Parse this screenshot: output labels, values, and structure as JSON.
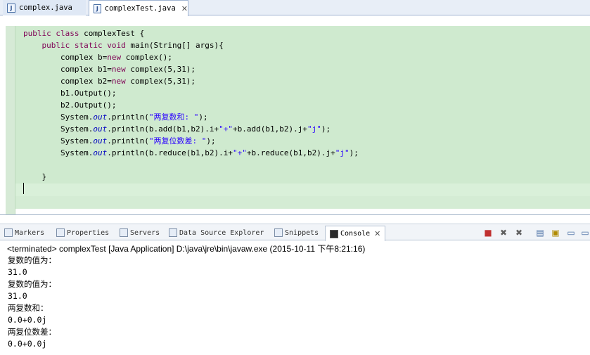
{
  "editor_tabs": [
    {
      "label": "complex.java",
      "active": false
    },
    {
      "label": "complexTest.java",
      "active": true
    }
  ],
  "code_lines": [
    [
      {
        "t": "public class",
        "c": "kw"
      },
      {
        "t": " complexTest {"
      }
    ],
    [
      {
        "t": "    "
      },
      {
        "t": "public static void",
        "c": "kw"
      },
      {
        "t": " main(String[] args){"
      }
    ],
    [
      {
        "t": "        complex b="
      },
      {
        "t": "new",
        "c": "kw"
      },
      {
        "t": " complex();"
      }
    ],
    [
      {
        "t": "        complex b1="
      },
      {
        "t": "new",
        "c": "kw"
      },
      {
        "t": " complex(5,31);"
      }
    ],
    [
      {
        "t": "        complex b2="
      },
      {
        "t": "new",
        "c": "kw"
      },
      {
        "t": " complex(5,31);"
      }
    ],
    [
      {
        "t": "        b1.Output();"
      }
    ],
    [
      {
        "t": "        b2.Output();"
      }
    ],
    [
      {
        "t": "        System."
      },
      {
        "t": "out",
        "c": "fld"
      },
      {
        "t": ".println("
      },
      {
        "t": "\"两复数和: \"",
        "c": "str"
      },
      {
        "t": ");"
      }
    ],
    [
      {
        "t": "        System."
      },
      {
        "t": "out",
        "c": "fld"
      },
      {
        "t": ".println(b.add(b1,b2).i+"
      },
      {
        "t": "\"+\"",
        "c": "str"
      },
      {
        "t": "+b.add(b1,b2).j+"
      },
      {
        "t": "\"j\"",
        "c": "str"
      },
      {
        "t": ");"
      }
    ],
    [
      {
        "t": "        System."
      },
      {
        "t": "out",
        "c": "fld"
      },
      {
        "t": ".println("
      },
      {
        "t": "\"两复位数差: \"",
        "c": "str"
      },
      {
        "t": ");"
      }
    ],
    [
      {
        "t": "        System."
      },
      {
        "t": "out",
        "c": "fld"
      },
      {
        "t": ".println(b.reduce(b1,b2).i+"
      },
      {
        "t": "\"+\"",
        "c": "str"
      },
      {
        "t": "+b.reduce(b1,b2).j+"
      },
      {
        "t": "\"j\"",
        "c": "str"
      },
      {
        "t": ");"
      }
    ],
    [
      {
        "t": ""
      }
    ],
    [
      {
        "t": "    }"
      }
    ]
  ],
  "view_tabs": [
    {
      "label": "Markers",
      "icon": "markers-icon"
    },
    {
      "label": "Properties",
      "icon": "properties-icon"
    },
    {
      "label": "Servers",
      "icon": "servers-icon"
    },
    {
      "label": "Data Source Explorer",
      "icon": "data-source-icon"
    },
    {
      "label": "Snippets",
      "icon": "snippets-icon"
    },
    {
      "label": "Console",
      "icon": "console-icon",
      "active": true
    }
  ],
  "console": {
    "status": "<terminated> complexTest [Java Application] D:\\java\\jre\\bin\\javaw.exe (2015-10-11 下午8:21:16)",
    "output": [
      "复数的值为：",
      "31.0",
      "复数的值为：",
      "31.0",
      "两复数和：",
      "0.0+0.0j",
      "两复位数差：",
      "0.0+0.0j"
    ]
  },
  "colors": {
    "keyword": "#7f0055",
    "string": "#2a00ff",
    "field": "#0000c0",
    "highlight": "#cfeacf"
  }
}
